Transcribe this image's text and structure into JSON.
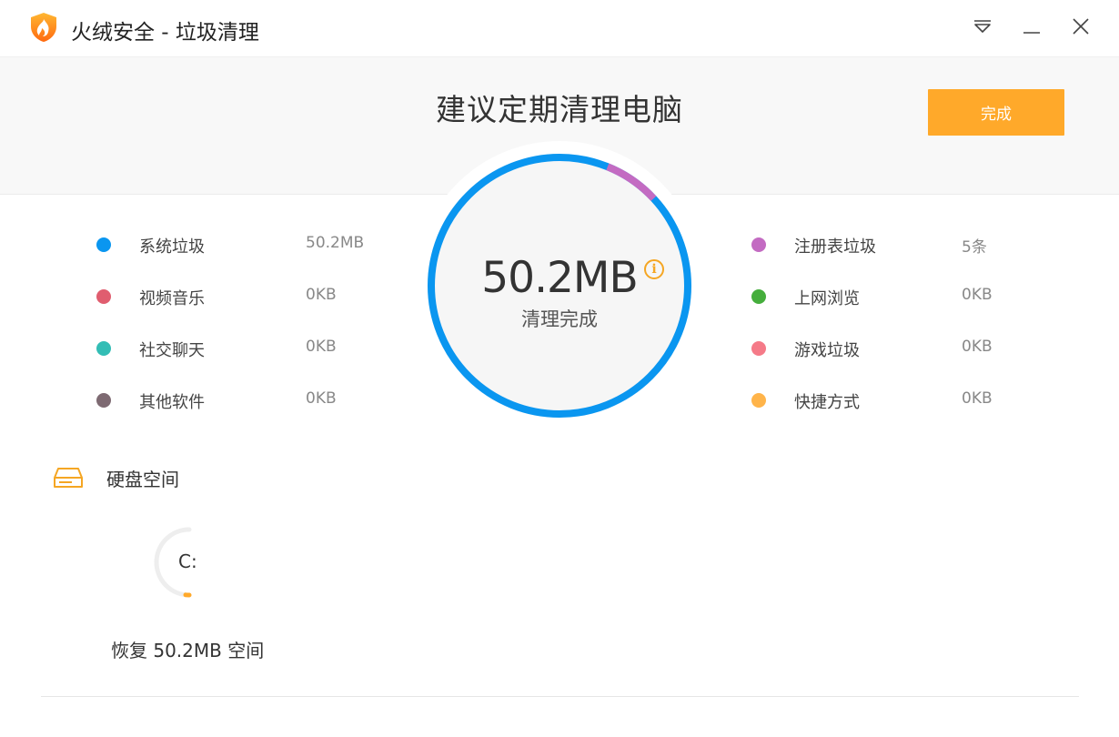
{
  "window": {
    "title": "火绒安全 - 垃圾清理",
    "controls": {
      "menu_icon": "dropdown-triangle-icon",
      "minimize_icon": "minimize-icon",
      "close_icon": "close-icon"
    }
  },
  "header": {
    "headline": "建议定期清理电脑",
    "done_label": "完成"
  },
  "summary": {
    "total": "50.2MB",
    "status": "清理完成",
    "info_icon": "info-icon",
    "ring_color": "#0a96f0",
    "ring_segment_color": "#c36bc2",
    "ring_segment_fraction": 0.07
  },
  "categories_left": [
    {
      "name": "系统垃圾",
      "size": "50.2MB",
      "color": "#0a96f0"
    },
    {
      "name": "视频音乐",
      "size": "0KB",
      "color": "#e05d6f"
    },
    {
      "name": "社交聊天",
      "size": "0KB",
      "color": "#33bdb5"
    },
    {
      "name": "其他软件",
      "size": "0KB",
      "color": "#7e6a72"
    }
  ],
  "categories_right": [
    {
      "name": "注册表垃圾",
      "size": "5条",
      "color": "#c36bc2"
    },
    {
      "name": "上网浏览",
      "size": "0KB",
      "color": "#45ae3c"
    },
    {
      "name": "游戏垃圾",
      "size": "0KB",
      "color": "#f57a88"
    },
    {
      "name": "快捷方式",
      "size": "0KB",
      "color": "#ffb44a"
    }
  ],
  "disk": {
    "section_title": "硬盘空间",
    "icon": "hard-drive-icon",
    "drive_letter": "C:",
    "recovered_text": "恢复 50.2MB 空间",
    "usage_fraction": 0.02,
    "accent_color": "#ffa92a"
  },
  "colors": {
    "accent": "#ffa92a",
    "logo": "#ff8a1e"
  }
}
